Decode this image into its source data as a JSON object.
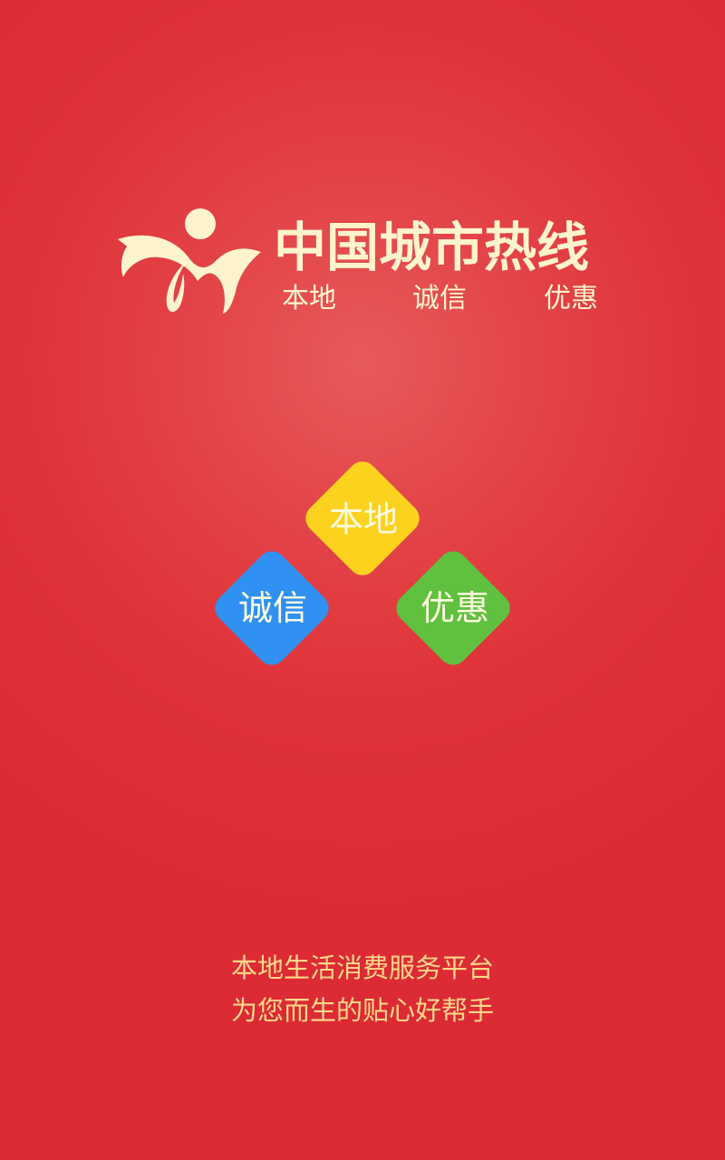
{
  "splash": {
    "app_name": "中国城市热线",
    "taglines": [
      "本地",
      "诚信",
      "优惠"
    ],
    "diamonds": {
      "top": {
        "label": "本地",
        "color": "#fcd21f"
      },
      "left": {
        "label": "诚信",
        "color": "#3091f2"
      },
      "right": {
        "label": "优惠",
        "color": "#60c03f"
      }
    },
    "slogan": [
      "本地生活消费服务平台",
      "为您而生的贴心好帮手"
    ],
    "colors": {
      "background": "#dd2b35",
      "logo": "#fdf4cd",
      "slogan": "#fbd78a",
      "diamond_text": "#fefbe0"
    },
    "icons": {
      "logo": "ribbon-figure-logo-icon"
    }
  }
}
